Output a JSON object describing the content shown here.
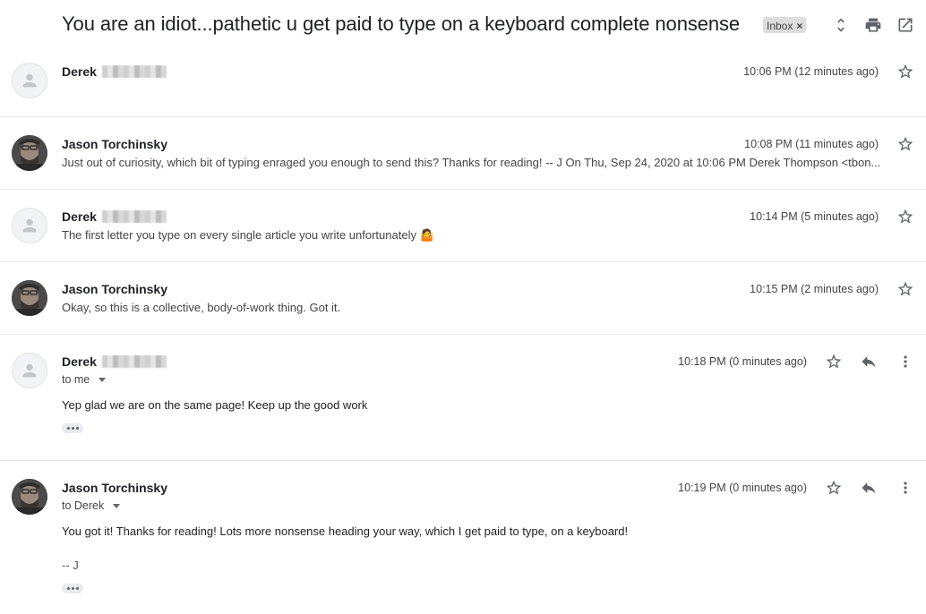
{
  "subject": "You are an idiot...pathetic u get paid to type on a keyboard complete nonsense",
  "label": {
    "text": "Inbox",
    "remove": "×"
  },
  "messages": [
    {
      "sender": "Derek",
      "time": "10:06 PM (12 minutes ago)",
      "snippet": ""
    },
    {
      "sender": "Jason Torchinsky",
      "time": "10:08 PM (11 minutes ago)",
      "snippet": "Just out of curiosity, which bit of typing enraged you enough to send this? Thanks for reading! -- J On Thu, Sep 24, 2020 at 10:06 PM Derek Thompson <tbon..."
    },
    {
      "sender": "Derek",
      "time": "10:14 PM (5 minutes ago)",
      "snippet": "The first letter you type on every single article you write unfortunately 🤷"
    },
    {
      "sender": "Jason Torchinsky",
      "time": "10:15 PM (2 minutes ago)",
      "snippet": "Okay, so this is a collective, body-of-work thing. Got it."
    },
    {
      "sender": "Derek",
      "time": "10:18 PM (0 minutes ago)",
      "to": "to me",
      "body": "Yep glad we are on the same page! Keep up the good work"
    },
    {
      "sender": "Jason Torchinsky",
      "time": "10:19 PM (0 minutes ago)",
      "to": "to Derek",
      "body": "You got it! Thanks for reading! Lots more nonsense heading your way, which I get paid to type, on a keyboard!",
      "signature": "-- J"
    }
  ],
  "icons": {
    "expand": "unfold-icon",
    "print": "print-icon",
    "popout": "open-new-window-icon",
    "star": "star-icon",
    "reply": "reply-icon",
    "more": "more-vert-icon"
  }
}
